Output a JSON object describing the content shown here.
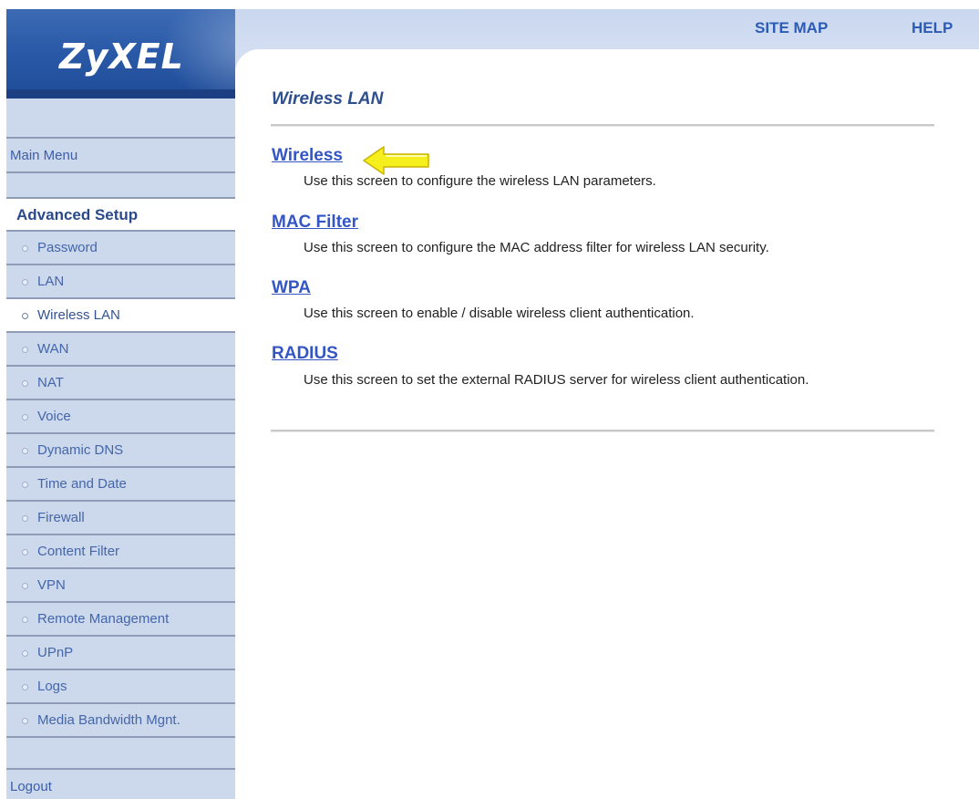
{
  "logo": {
    "text": "ZyXEL"
  },
  "toplinks": {
    "site_map": "SITE MAP",
    "help": "HELP"
  },
  "sidebar": {
    "main_menu": "Main Menu",
    "section_header": "Advanced Setup",
    "items": [
      "Password",
      "LAN",
      "Wireless LAN",
      "WAN",
      "NAT",
      "Voice",
      "Dynamic DNS",
      "Time and Date",
      "Firewall",
      "Content Filter",
      "VPN",
      "Remote Management",
      "UPnP",
      "Logs",
      "Media Bandwidth Mgnt."
    ],
    "active_item": "Wireless LAN",
    "logout": "Logout"
  },
  "main": {
    "title": "Wireless LAN",
    "entries": [
      {
        "link": "Wireless",
        "description": "Use this screen to configure the wireless LAN parameters."
      },
      {
        "link": "MAC Filter",
        "description": "Use this screen to configure the MAC address filter for wireless LAN security."
      },
      {
        "link": "WPA",
        "description": "Use this screen to enable / disable wireless client authentication."
      },
      {
        "link": "RADIUS",
        "description": "Use this screen to set the external RADIUS server for wireless client authentication."
      }
    ],
    "highlighted_entry": "Wireless"
  },
  "colors": {
    "sidebar_bg": "#ccd8ec",
    "logo_bg": "#2a5aa8",
    "link": "#3455c4",
    "arrow": "#f5ef1e"
  },
  "icons": {
    "pointer": "yellow-arrow-left-icon",
    "bullet": "radio-bullet-icon"
  }
}
